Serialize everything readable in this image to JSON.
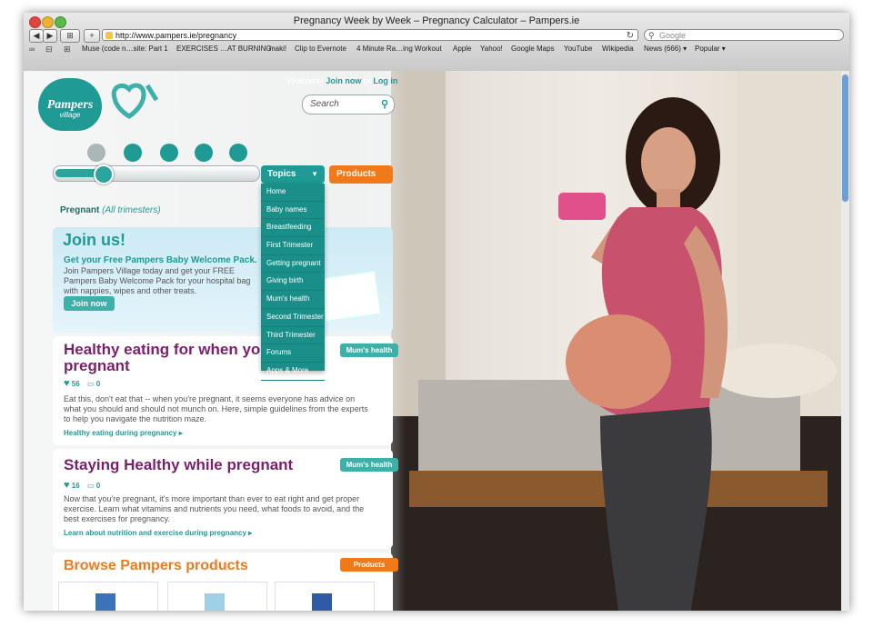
{
  "browser": {
    "window_title": "Pregnancy Week by Week – Pregnancy Calculator – Pampers.ie",
    "url": "http://www.pampers.ie/pregnancy",
    "search_placeholder": "Google",
    "back_label": "◀",
    "forward_label": "▶",
    "add_label": "+",
    "bookmarks": [
      "Muse (code n…site: Part 1",
      "EXERCISES …AT BURNING",
      "maki!",
      "Clip to Evernote",
      "4 Minute Ra…ing Workout",
      "Apple",
      "Yahoo!",
      "Google Maps",
      "YouTube",
      "Wikipedia",
      "News (666) ▾",
      "Popular ▾"
    ]
  },
  "site": {
    "logo_brand": "Pampers",
    "logo_sub": "village",
    "welcome": "Welcome!",
    "join_link": "Join now",
    "or": " or ",
    "login_link": "Log in",
    "search_placeholder": "Search",
    "topics_label": "Topics",
    "products_label": "Products",
    "menu_items": [
      "Home",
      "Baby names",
      "Breastfeeding",
      "First Trimester",
      "Getting pregnant",
      "Giving birth",
      "Mum's health",
      "Second Trimester",
      "Third Trimester",
      "Forums",
      "Apps & More"
    ],
    "crumb_main": "Pregnant",
    "crumb_sub": "(All trimesters)"
  },
  "join": {
    "title": "Join us!",
    "lead": "Get your Free Pampers Baby Welcome Pack.",
    "body": "Join Pampers Village today and get your FREE Pampers Baby Welcome Pack for your hospital bag with nappies, wipes and other treats.",
    "button": "Join now"
  },
  "articles": [
    {
      "title": "Healthy eating for when you're pregnant",
      "tag": "Mum's health",
      "likes": "56",
      "comments": "0",
      "body": "Eat this, don't eat that -- when you're pregnant, it seems everyone has advice on what you should and should not munch on. Here, simple guidelines from the experts to help you navigate the nutrition maze.",
      "link": "Healthy eating during pregnancy ▸"
    },
    {
      "title": "Staying Healthy while pregnant",
      "tag": "Mum's health",
      "likes": "16",
      "comments": "0",
      "body": "Now that you're pregnant, it's more important than ever to eat right and get proper exercise. Learn what vitamins and nutrients you need, what foods to avoid, and the best exercises for pregnancy.",
      "link": "Learn about nutrition and exercise during pregnancy ▸"
    }
  ],
  "browse": {
    "title": "Browse Pampers products",
    "tag": "Products"
  },
  "colors": {
    "teal": "#1f9a94",
    "purple": "#7b1f6d",
    "orange": "#f07a1a"
  }
}
